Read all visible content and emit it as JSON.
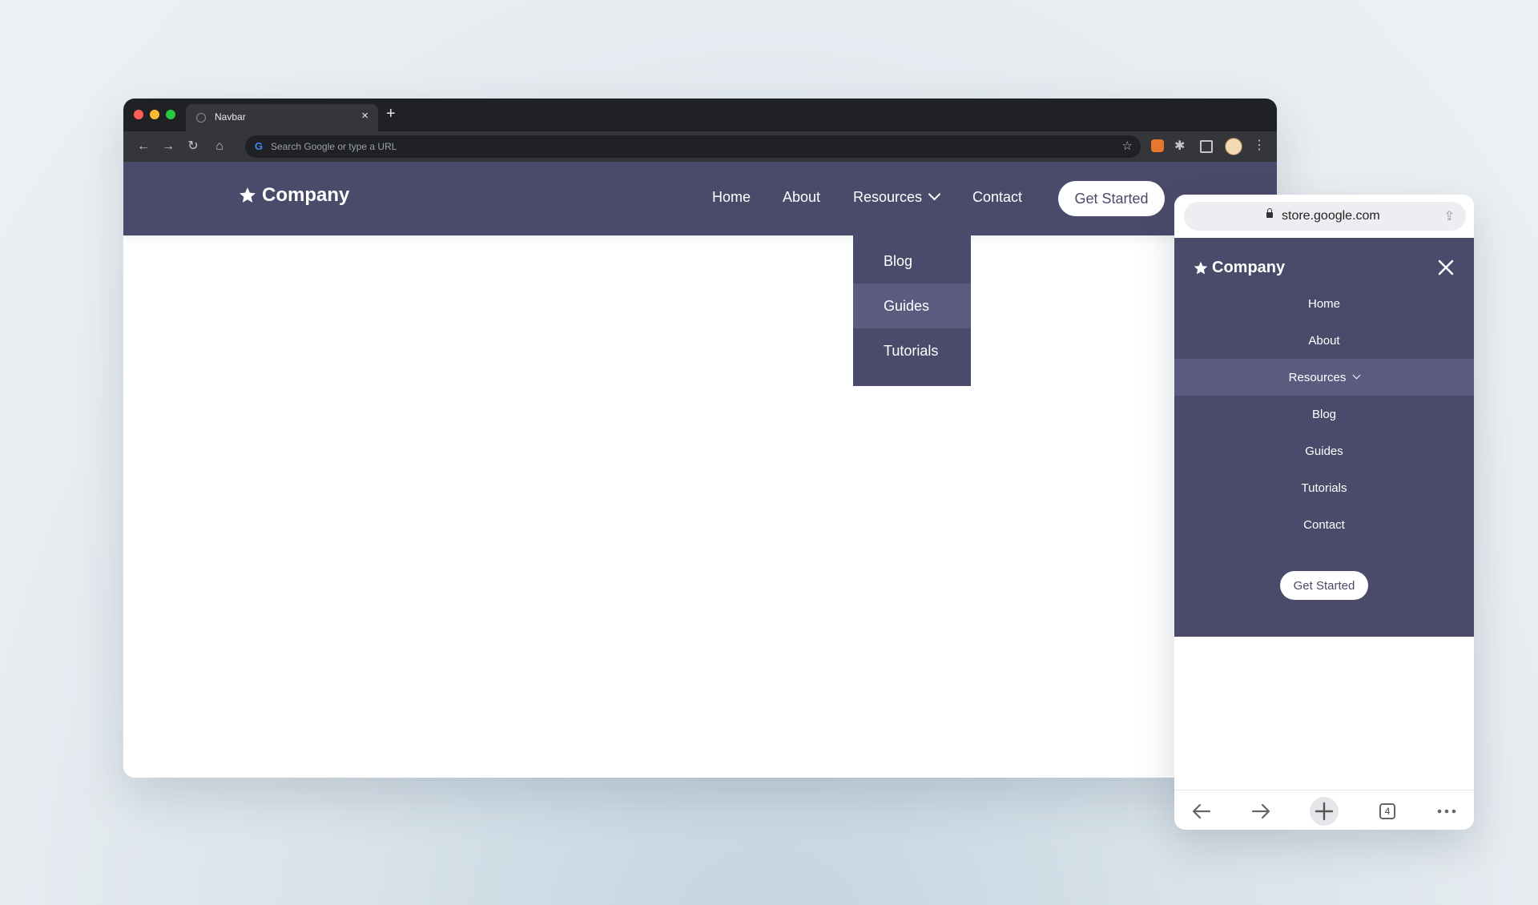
{
  "desktop": {
    "tab_title": "Navbar",
    "address_placeholder": "Search Google or type a URL",
    "google_letter": "G",
    "nav": {
      "brand": "Company",
      "links": [
        "Home",
        "About",
        "Resources",
        "Contact"
      ],
      "cta": "Get Started"
    },
    "dropdown": {
      "items": [
        "Blog",
        "Guides",
        "Tutorials"
      ],
      "active": "Guides"
    }
  },
  "mobile": {
    "url": "store.google.com",
    "brand": "Company",
    "menu_items": [
      "Home",
      "About",
      "Resources",
      "Blog",
      "Guides",
      "Tutorials",
      "Contact"
    ],
    "active": "Resources",
    "cta": "Get Started",
    "tab_count": "4"
  },
  "colors": {
    "nav_bg": "#4a4a6a",
    "active_item_bg": "#5b5b80",
    "cta_bg": "#ffffff",
    "cta_text": "#4a4a6a"
  },
  "icons": [
    "star-icon",
    "chevron-down-icon",
    "close-icon",
    "lock-icon",
    "share-icon",
    "back-icon",
    "forward-icon",
    "plus-icon",
    "tabs-icon",
    "more-icon",
    "reload-icon",
    "home-icon",
    "bookmark-star-icon",
    "extensions-icon",
    "side-panel-icon",
    "kebab-icon",
    "globe-icon"
  ]
}
